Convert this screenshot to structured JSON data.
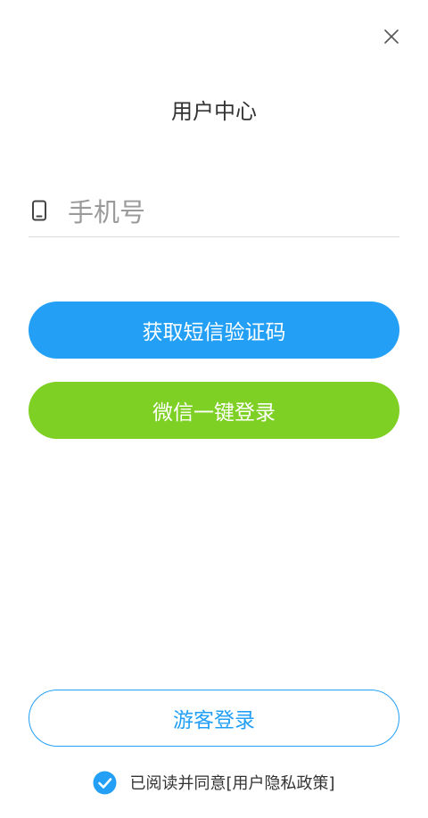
{
  "header": {
    "title": "用户中心",
    "close_icon": "close-icon"
  },
  "phone": {
    "icon": "mobile-phone-icon",
    "placeholder": "手机号",
    "value": ""
  },
  "buttons": {
    "sms_label": "获取短信验证码",
    "wechat_label": "微信一键登录",
    "guest_label": "游客登录"
  },
  "agreement": {
    "checked": true,
    "text": "已阅读并同意",
    "link": "[用户隐私政策]"
  },
  "colors": {
    "primary": "#23a0f6",
    "wechat": "#7ed024",
    "text": "#333333",
    "placeholder": "#9a9a9a",
    "divider": "#d9d9d9"
  }
}
